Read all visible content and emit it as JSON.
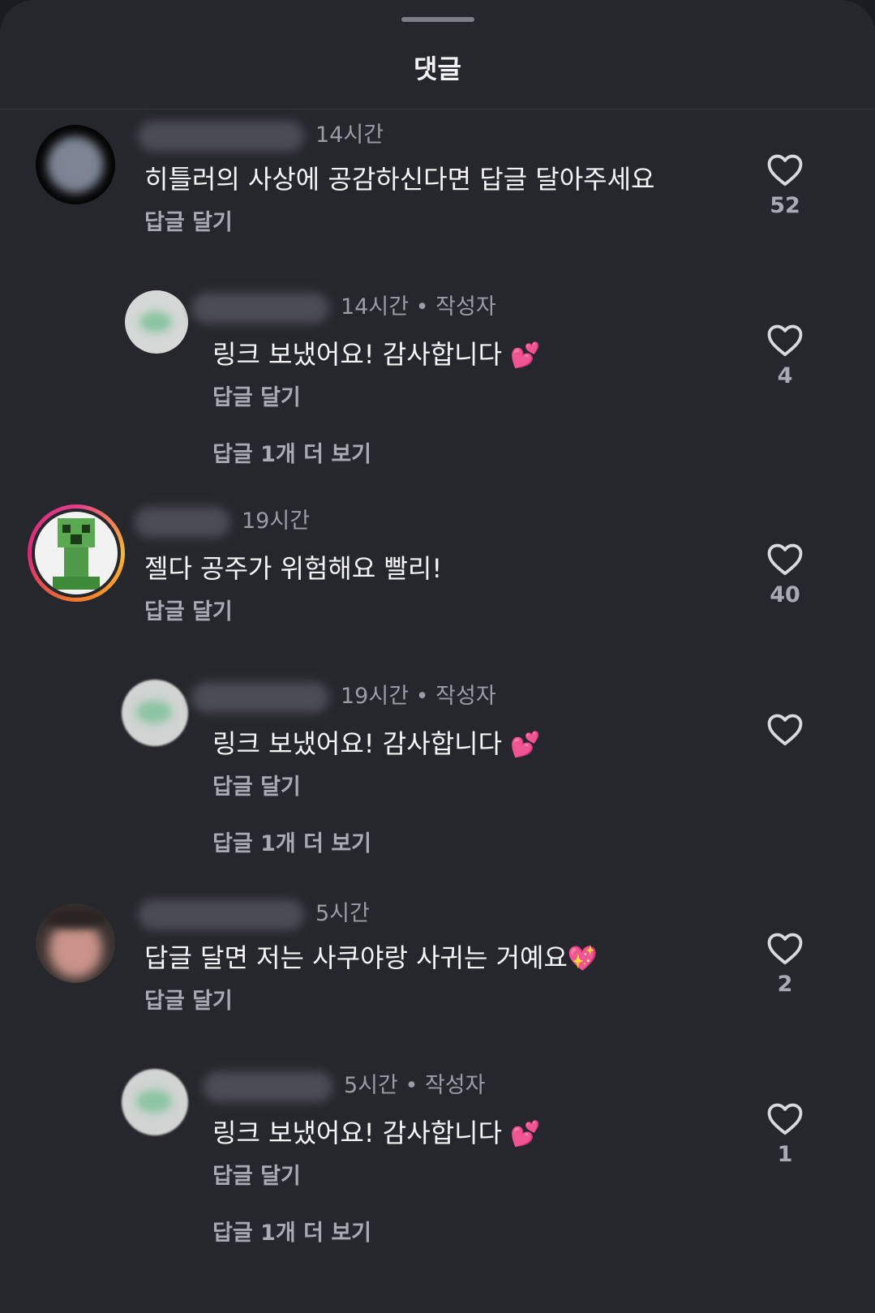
{
  "header": {
    "title": "댓글"
  },
  "comments": [
    {
      "time": "14시간",
      "text": "히틀러의 사상에 공감하신다면 답글 달아주세요",
      "reply_label": "답글 달기",
      "likes": "52"
    },
    {
      "time": "14시간",
      "author_tag": "작성자",
      "text": "링크 보냈어요! 감사합니다",
      "emoji": "💕",
      "reply_label": "답글 달기",
      "likes": "4",
      "more_label": "답글 1개 더 보기"
    },
    {
      "time": "19시간",
      "text": "젤다 공주가 위험해요 빨리!",
      "reply_label": "답글 달기",
      "likes": "40"
    },
    {
      "time": "19시간",
      "author_tag": "작성자",
      "text": "링크 보냈어요! 감사합니다",
      "emoji": "💕",
      "reply_label": "답글 달기",
      "likes": "",
      "more_label": "답글 1개 더 보기"
    },
    {
      "time": "5시간",
      "text": "답글 달면 저는 사쿠야랑 사귀는 거예요",
      "emoji": "💖",
      "reply_label": "답글 달기",
      "likes": "2"
    },
    {
      "time": "5시간",
      "author_tag": "작성자",
      "text": "링크 보냈어요! 감사합니다",
      "emoji": "💕",
      "reply_label": "답글 달기",
      "likes": "1",
      "more_label": "답글 1개 더 보기"
    }
  ],
  "colors": {
    "background": "#25272c",
    "text": "#f5f5f5",
    "muted": "#9a9da3"
  },
  "icons": {
    "like": "heart-outline-icon"
  }
}
